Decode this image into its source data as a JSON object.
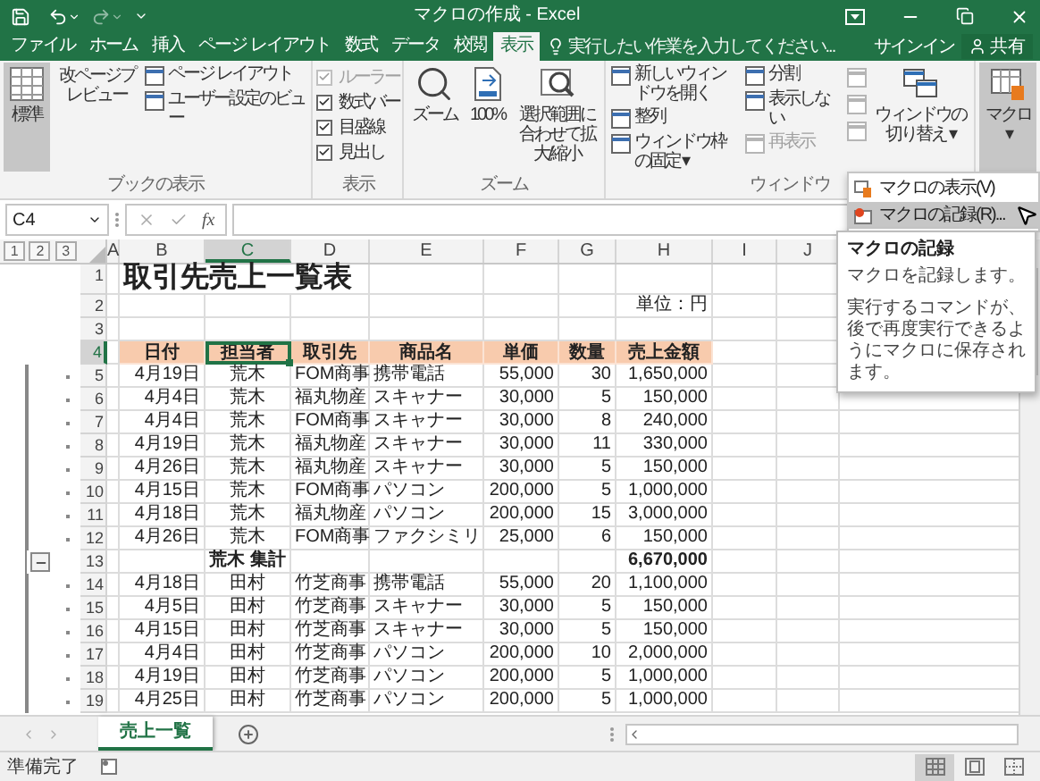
{
  "window": {
    "title": "マクロの作成 - Excel"
  },
  "tabs": [
    {
      "label": "ファイル",
      "selected": false
    },
    {
      "label": "ホーム",
      "selected": false
    },
    {
      "label": "挿入",
      "selected": false
    },
    {
      "label": "ページ レイアウト",
      "selected": false
    },
    {
      "label": "数式",
      "selected": false
    },
    {
      "label": "データ",
      "selected": false
    },
    {
      "label": "校閲",
      "selected": false
    },
    {
      "label": "表示",
      "selected": true
    }
  ],
  "tell_me": {
    "placeholder": "実行したい作業を入力してください..."
  },
  "account": {
    "sign_in": "サインイン",
    "share": "共有"
  },
  "ribbon": {
    "groups": [
      {
        "label": "ブックの表示",
        "columns": [
          [
            {
              "kind": "large",
              "label": "標準",
              "selected": true,
              "disabled": false
            }
          ],
          [
            {
              "kind": "large",
              "label": "改ページプレビュー",
              "selected": false,
              "disabled": false
            }
          ],
          [
            {
              "kind": "small",
              "label": "ページ レイアウト",
              "selected": false,
              "disabled": false
            },
            {
              "kind": "small",
              "label": "ユーザー設定のビュー",
              "selected": false,
              "disabled": false
            }
          ]
        ]
      },
      {
        "label": "表示",
        "columns": [
          [
            {
              "kind": "check",
              "label": "ルーラー",
              "checked": true,
              "disabled": true
            },
            {
              "kind": "check",
              "label": "数式バー",
              "checked": true,
              "disabled": false
            },
            {
              "kind": "check",
              "label": "目盛線",
              "checked": true,
              "disabled": false
            },
            {
              "kind": "check",
              "label": "見出し",
              "checked": true,
              "disabled": false
            }
          ]
        ]
      },
      {
        "label": "ズーム",
        "columns": [
          [
            {
              "kind": "large",
              "label": "ズーム",
              "selected": false,
              "disabled": false
            }
          ],
          [
            {
              "kind": "large",
              "label": "100%",
              "selected": false,
              "disabled": false
            }
          ],
          [
            {
              "kind": "large",
              "label": "選択範囲に合わせて拡大/縮小",
              "selected": false,
              "disabled": false
            }
          ]
        ]
      },
      {
        "label": "ウィンドウ",
        "columns": [
          [
            {
              "kind": "small",
              "label": "新しいウィンドウを開く",
              "selected": false,
              "disabled": false
            },
            {
              "kind": "small",
              "label": "整列",
              "selected": false,
              "disabled": false
            },
            {
              "kind": "small",
              "label": "ウィンドウ枠の固定 ▾",
              "selected": false,
              "disabled": false
            }
          ],
          [
            {
              "kind": "small",
              "label": "分割",
              "selected": false,
              "disabled": false
            },
            {
              "kind": "small",
              "label": "表示しない",
              "selected": false,
              "disabled": false
            },
            {
              "kind": "small",
              "label": "再表示",
              "selected": false,
              "disabled": true
            }
          ],
          [
            {
              "kind": "icon",
              "selected": false,
              "disabled": true
            },
            {
              "kind": "icon",
              "selected": false,
              "disabled": true
            },
            {
              "kind": "icon",
              "selected": false,
              "disabled": true
            }
          ],
          [
            {
              "kind": "large",
              "label": "ウィンドウの切り替え ▾",
              "selected": false,
              "disabled": false
            }
          ]
        ]
      },
      {
        "columns": [
          [
            {
              "kind": "large",
              "label": "マクロ ▾",
              "selected": true,
              "disabled": false
            }
          ]
        ]
      }
    ]
  },
  "formula_bar": {
    "name_box": "C4",
    "fx": "fx"
  },
  "outline_levels": [
    "1",
    "2",
    "3"
  ],
  "columns": [
    {
      "label": "A",
      "selected": false
    },
    {
      "label": "B",
      "selected": false
    },
    {
      "label": "C",
      "selected": true
    },
    {
      "label": "D",
      "selected": false
    },
    {
      "label": "E",
      "selected": false
    },
    {
      "label": "F",
      "selected": false
    },
    {
      "label": "G",
      "selected": false
    },
    {
      "label": "H",
      "selected": false
    },
    {
      "label": "I",
      "selected": false
    },
    {
      "label": "J",
      "selected": false
    }
  ],
  "rows": [
    {
      "num": "1",
      "kind": "title",
      "selected": false,
      "cells": {
        "B": "取引先売上一覧表"
      }
    },
    {
      "num": "2",
      "kind": "note",
      "selected": false,
      "cells": {
        "H": "単位：円"
      }
    },
    {
      "num": "3",
      "kind": "blank",
      "selected": false
    },
    {
      "num": "4",
      "kind": "header",
      "selected": true,
      "cells": {
        "B": "日付",
        "C": "担当者",
        "D": "取引先",
        "E": "商品名",
        "F": "単価",
        "G": "数量",
        "H": "売上金額"
      }
    },
    {
      "num": "5",
      "kind": "detail",
      "selected": false,
      "cells": {
        "B": "4月19日",
        "C": "荒木",
        "D": "FOM商事",
        "E": "携帯電話",
        "F": "55,000",
        "G": "30",
        "H": "1,650,000"
      }
    },
    {
      "num": "6",
      "kind": "detail",
      "selected": false,
      "cells": {
        "B": "4月4日",
        "C": "荒木",
        "D": "福丸物産",
        "E": "スキャナー",
        "F": "30,000",
        "G": "5",
        "H": "150,000"
      }
    },
    {
      "num": "7",
      "kind": "detail",
      "selected": false,
      "cells": {
        "B": "4月4日",
        "C": "荒木",
        "D": "FOM商事",
        "E": "スキャナー",
        "F": "30,000",
        "G": "8",
        "H": "240,000"
      }
    },
    {
      "num": "8",
      "kind": "detail",
      "selected": false,
      "cells": {
        "B": "4月19日",
        "C": "荒木",
        "D": "福丸物産",
        "E": "スキャナー",
        "F": "30,000",
        "G": "11",
        "H": "330,000"
      }
    },
    {
      "num": "9",
      "kind": "detail",
      "selected": false,
      "cells": {
        "B": "4月26日",
        "C": "荒木",
        "D": "福丸物産",
        "E": "スキャナー",
        "F": "30,000",
        "G": "5",
        "H": "150,000"
      }
    },
    {
      "num": "10",
      "kind": "detail",
      "selected": false,
      "cells": {
        "B": "4月15日",
        "C": "荒木",
        "D": "FOM商事",
        "E": "パソコン",
        "F": "200,000",
        "G": "5",
        "H": "1,000,000"
      }
    },
    {
      "num": "11",
      "kind": "detail",
      "selected": false,
      "cells": {
        "B": "4月18日",
        "C": "荒木",
        "D": "福丸物産",
        "E": "パソコン",
        "F": "200,000",
        "G": "15",
        "H": "3,000,000"
      }
    },
    {
      "num": "12",
      "kind": "detail",
      "selected": false,
      "cells": {
        "B": "4月26日",
        "C": "荒木",
        "D": "FOM商事",
        "E": "ファクシミリ",
        "F": "25,000",
        "G": "6",
        "H": "150,000"
      }
    },
    {
      "num": "13",
      "kind": "subtotal",
      "selected": false,
      "cells": {
        "C": "荒木 集計",
        "H": "6,670,000"
      }
    },
    {
      "num": "14",
      "kind": "detail",
      "selected": false,
      "cells": {
        "B": "4月18日",
        "C": "田村",
        "D": "竹芝商事",
        "E": "携帯電話",
        "F": "55,000",
        "G": "20",
        "H": "1,100,000"
      }
    },
    {
      "num": "15",
      "kind": "detail",
      "selected": false,
      "cells": {
        "B": "4月5日",
        "C": "田村",
        "D": "竹芝商事",
        "E": "スキャナー",
        "F": "30,000",
        "G": "5",
        "H": "150,000"
      }
    },
    {
      "num": "16",
      "kind": "detail",
      "selected": false,
      "cells": {
        "B": "4月15日",
        "C": "田村",
        "D": "竹芝商事",
        "E": "スキャナー",
        "F": "30,000",
        "G": "5",
        "H": "150,000"
      }
    },
    {
      "num": "17",
      "kind": "detail",
      "selected": false,
      "cells": {
        "B": "4月4日",
        "C": "田村",
        "D": "竹芝商事",
        "E": "パソコン",
        "F": "200,000",
        "G": "10",
        "H": "2,000,000"
      }
    },
    {
      "num": "18",
      "kind": "detail",
      "selected": false,
      "cells": {
        "B": "4月19日",
        "C": "田村",
        "D": "竹芝商事",
        "E": "パソコン",
        "F": "200,000",
        "G": "5",
        "H": "1,000,000"
      }
    },
    {
      "num": "19",
      "kind": "detail",
      "selected": false,
      "cells": {
        "B": "4月25日",
        "C": "田村",
        "D": "竹芝商事",
        "E": "パソコン",
        "F": "200,000",
        "G": "5",
        "H": "1,000,000"
      }
    }
  ],
  "sheet_tabs": [
    {
      "label": "売上一覧",
      "selected": true
    }
  ],
  "status_bar": {
    "text": "準備完了",
    "view_buttons": [
      {
        "selected": true
      },
      {
        "selected": false
      },
      {
        "selected": false
      }
    ]
  },
  "macro_menu": {
    "items": [
      {
        "label": "マクロの表示(V)",
        "selected": false
      },
      {
        "label": "マクロの記録(R)...",
        "selected": true
      }
    ]
  },
  "tooltip": {
    "title": "マクロの記録",
    "text": "マクロを記録します。",
    "detail": "実行するコマンドが、後で再度実行できるようにマクロに保存されます。"
  }
}
